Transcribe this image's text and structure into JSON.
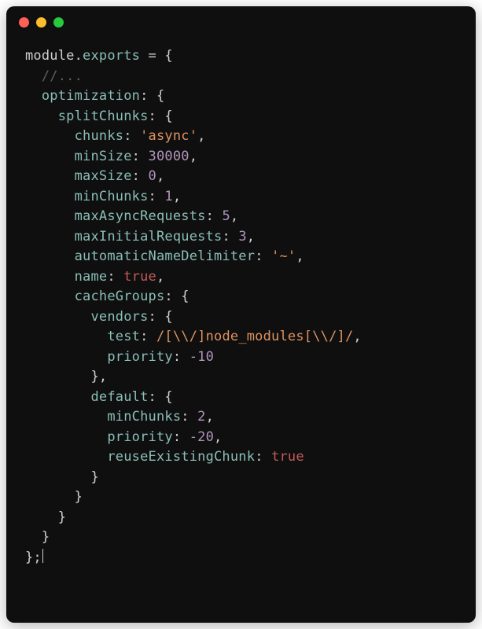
{
  "titlebar": {
    "buttons": [
      "close",
      "minimize",
      "maximize"
    ]
  },
  "code": {
    "line1_module": "module",
    "line1_dot": ".",
    "line1_exports": "exports",
    "line1_rest": " = {",
    "line2_comment": "  //...",
    "line3_prop": "  optimization",
    "line3_rest": ": {",
    "line4_prop": "    splitChunks",
    "line4_rest": ": {",
    "line5_prop": "      chunks",
    "line5_colon": ": ",
    "line5_val": "'async'",
    "line5_comma": ",",
    "line6_prop": "      minSize",
    "line6_colon": ": ",
    "line6_val": "30000",
    "line6_comma": ",",
    "line7_prop": "      maxSize",
    "line7_colon": ": ",
    "line7_val": "0",
    "line7_comma": ",",
    "line8_prop": "      minChunks",
    "line8_colon": ": ",
    "line8_val": "1",
    "line8_comma": ",",
    "line9_prop": "      maxAsyncRequests",
    "line9_colon": ": ",
    "line9_val": "5",
    "line9_comma": ",",
    "line10_prop": "      maxInitialRequests",
    "line10_colon": ": ",
    "line10_val": "3",
    "line10_comma": ",",
    "line11_prop": "      automaticNameDelimiter",
    "line11_colon": ": ",
    "line11_val": "'~'",
    "line11_comma": ",",
    "line12_prop": "      name",
    "line12_colon": ": ",
    "line12_val": "true",
    "line12_comma": ",",
    "line13_prop": "      cacheGroups",
    "line13_rest": ": {",
    "line14_prop": "        vendors",
    "line14_rest": ": {",
    "line15_prop": "          test",
    "line15_colon": ": ",
    "line15_val": "/[\\\\/]node_modules[\\\\/]/",
    "line15_comma": ",",
    "line16_prop": "          priority",
    "line16_colon": ": ",
    "line16_val": "-10",
    "line17_close": "        },",
    "line18_prop": "        default",
    "line18_rest": ": {",
    "line19_prop": "          minChunks",
    "line19_colon": ": ",
    "line19_val": "2",
    "line19_comma": ",",
    "line20_prop": "          priority",
    "line20_colon": ": ",
    "line20_val": "-20",
    "line20_comma": ",",
    "line21_prop": "          reuseExistingChunk",
    "line21_colon": ": ",
    "line21_val": "true",
    "line22_close": "        }",
    "line23_close": "      }",
    "line24_close": "    }",
    "line25_close": "  }",
    "line26_close": "};"
  }
}
